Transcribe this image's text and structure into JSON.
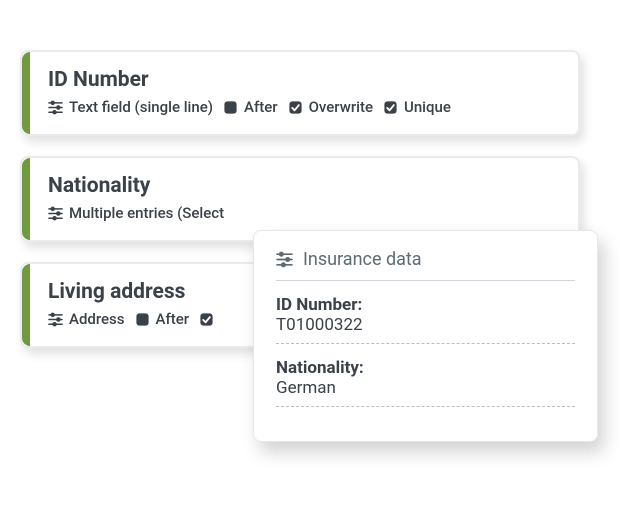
{
  "fields": [
    {
      "title": "ID Number",
      "type_label": "Text field (single line)",
      "after_label": "After",
      "after_checked": false,
      "overwrite_label": "Overwrite",
      "overwrite_checked": true,
      "unique_label": "Unique",
      "unique_checked": true
    },
    {
      "title": "Nationality",
      "type_label": "Multiple entries (Select"
    },
    {
      "title": "Living address",
      "type_label": "Address",
      "after_label": "After",
      "after_checked": false
    }
  ],
  "popup": {
    "title": "Insurance data",
    "rows": [
      {
        "label": "ID Number:",
        "value": "T01000322"
      },
      {
        "label": "Nationality:",
        "value": "German"
      }
    ]
  },
  "icons": {
    "sliders": "sliders-icon",
    "checkbox_checked": "checkbox-checked-icon",
    "checkbox_unchecked": "checkbox-unchecked-icon"
  },
  "colors": {
    "accent": "#6f9a3e",
    "text": "#3a4149",
    "icon": "#3a4149"
  }
}
